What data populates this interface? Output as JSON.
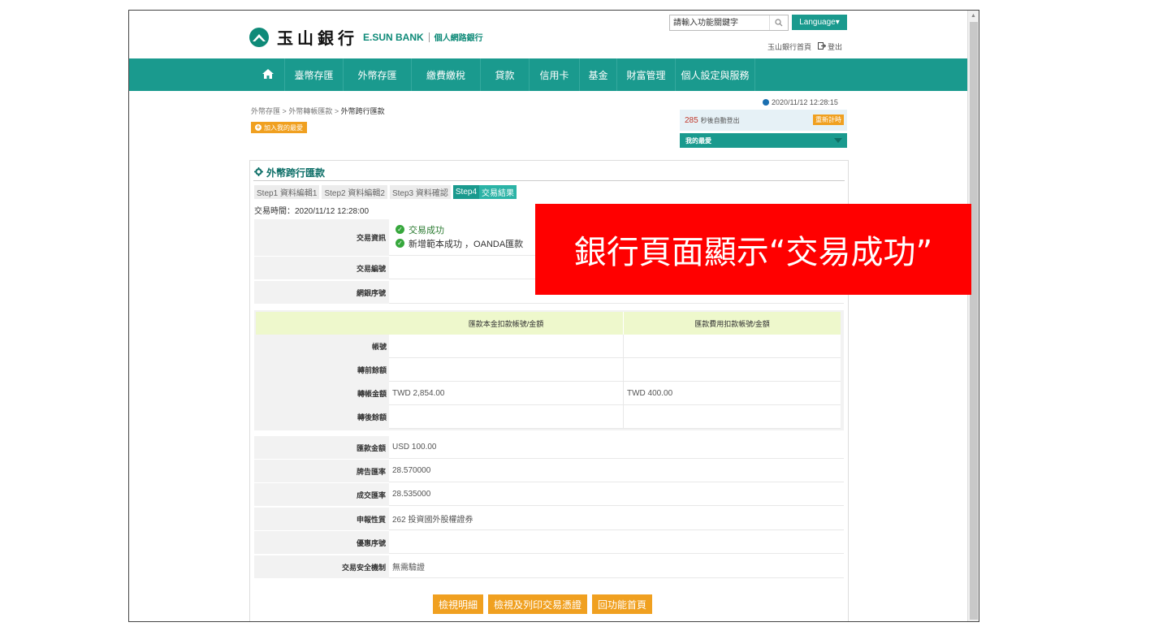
{
  "header": {
    "logo_cn": "玉山銀行",
    "logo_en": "E.SUN BANK",
    "logo_sub": "個人網路銀行",
    "search_placeholder": "請輸入功能關鍵字",
    "language_label": "Language▾",
    "home_link": "玉山銀行首頁",
    "logout_label": "登出"
  },
  "nav": {
    "items": [
      {
        "label": "臺幣存匯",
        "w": 72
      },
      {
        "label": "外幣存匯",
        "w": 84
      },
      {
        "label": "繳費繳稅",
        "w": 85
      },
      {
        "label": "貸款",
        "w": 60
      },
      {
        "label": "信用卡",
        "w": 62
      },
      {
        "label": "基金",
        "w": 46
      },
      {
        "label": "財富管理",
        "w": 72
      },
      {
        "label": "個人設定與服務",
        "w": 98
      }
    ]
  },
  "breadcrumb": {
    "level1": "外幣存匯",
    "level2": "外幣轉帳匯款",
    "current": "外幣跨行匯款",
    "sep": ">"
  },
  "favorite_button": "加入我的最愛",
  "session": {
    "clock": "2020/11/12 12:28:15",
    "count": "285",
    "count_suffix": "秒後自動登出",
    "renew": "重新計時",
    "my_favorites": "我的最愛"
  },
  "panel": {
    "title": "外幣跨行匯款",
    "steps": [
      {
        "label": "Step1 資料編輯1"
      },
      {
        "label": "Step2 資料編輯2"
      },
      {
        "label": "Step3 資料確認"
      }
    ],
    "active_step_num": "Step4",
    "active_step_label": "交易結果",
    "tx_time": "交易時間：2020/11/12 12:28:00",
    "info_label": "交易資訊",
    "info_line1": "交易成功",
    "info_line2": "新增範本成功 ，OANDA匯款",
    "tx_no_label": "交易編號",
    "tx_no_value": "",
    "seq_label": "網銀序號",
    "seq_value": "",
    "acct_head_1": "匯款本金扣款帳號/金額",
    "acct_head_2": "匯款費用扣款帳號/金額",
    "acct_rows": [
      {
        "label": "帳號",
        "c1": "",
        "c2": ""
      },
      {
        "label": "轉前餘額",
        "c1": "",
        "c2": ""
      },
      {
        "label": "轉帳金額",
        "c1": "TWD 2,854.00",
        "c2": "TWD 400.00"
      },
      {
        "label": "轉後餘額",
        "c1": "",
        "c2": ""
      }
    ],
    "detail_rows": [
      {
        "label": "匯款金額",
        "value": "USD 100.00"
      },
      {
        "label": "牌告匯率",
        "value": "28.570000"
      },
      {
        "label": "成交匯率",
        "value": "28.535000"
      },
      {
        "label": "申報性質",
        "value": "262 投資國外股權證券"
      },
      {
        "label": "優惠序號",
        "value": ""
      },
      {
        "label": "交易安全機制",
        "value": "無需驗證"
      }
    ],
    "buttons": [
      "檢視明細",
      "檢視及列印交易憑證",
      "回功能首頁"
    ]
  },
  "overlay_text": "銀行頁面顯示“交易成功”",
  "colors": {
    "brand_teal": "#1a9a8e",
    "accent_orange": "#f0a020",
    "overlay_red": "#ff0000",
    "success_green": "#36a73c"
  }
}
